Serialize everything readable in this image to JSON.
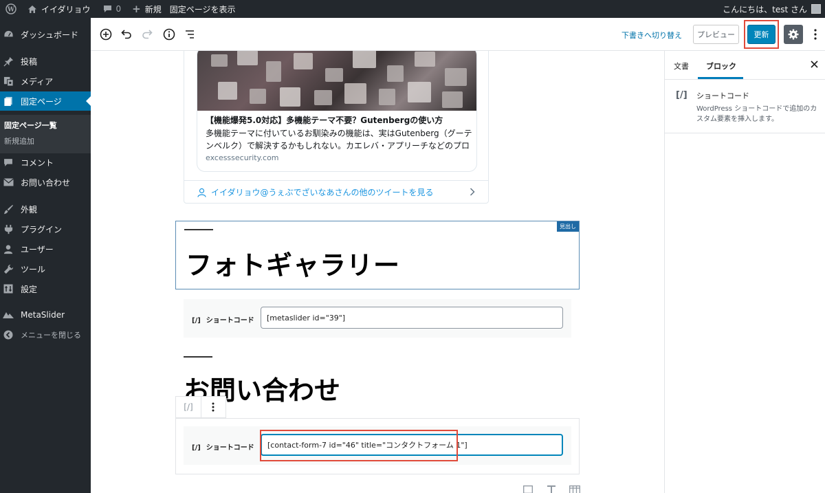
{
  "admin_bar": {
    "site_name": "イイダリョウ",
    "comments_count": "0",
    "new_label": "新規",
    "view_page_label": "固定ページを表示",
    "greeting": "こんにちは、test さん"
  },
  "sidebar": {
    "items": [
      {
        "label": "ダッシュボード",
        "icon": "dashboard-icon"
      },
      {
        "label": "投稿",
        "icon": "pin-icon"
      },
      {
        "label": "メディア",
        "icon": "media-icon"
      },
      {
        "label": "固定ページ",
        "icon": "page-icon"
      },
      {
        "label": "コメント",
        "icon": "comment-icon"
      },
      {
        "label": "お問い合わせ",
        "icon": "mail-icon"
      },
      {
        "label": "外観",
        "icon": "brush-icon"
      },
      {
        "label": "プラグイン",
        "icon": "plugin-icon"
      },
      {
        "label": "ユーザー",
        "icon": "user-icon"
      },
      {
        "label": "ツール",
        "icon": "wrench-icon"
      },
      {
        "label": "設定",
        "icon": "settings-icon"
      },
      {
        "label": "MetaSlider",
        "icon": "metaslider-icon"
      },
      {
        "label": "メニューを閉じる",
        "icon": "collapse-icon"
      }
    ],
    "submenu": [
      "固定ページ一覧",
      "新規追加"
    ]
  },
  "header": {
    "switch_draft": "下書きへ切り替え",
    "preview": "プレビュー",
    "update": "更新"
  },
  "embed": {
    "title": "【機能爆発5.0対応】多機能テーマ不要？Gutenbergの使い方",
    "description": "多機能テーマに付いているお馴染みの機能は、実はGutenberg（グーテンベルク）で解決するかもしれない。カエレバ・アプリーチなどのプロ",
    "domain": "excesssecurity.com",
    "more_tweets": "イイダリョウ@うぇぶでざいなあさんの他のツイートを見る"
  },
  "blocks": {
    "heading1": "フォトギャラリー",
    "heading1_label": "見出し",
    "shortcode_label": "ショートコード",
    "shortcode1_value": "[metaslider id=\"39\"]",
    "heading2": "お問い合わせ",
    "shortcode2_value": "[contact-form-7 id=\"46\" title=\"コンタクトフォーム 1\"]",
    "toolbar_icon": "[/]"
  },
  "panel": {
    "tab_document": "文書",
    "tab_block": "ブロック",
    "block_icon": "[/]",
    "block_title": "ショートコード",
    "block_description": "WordPress ショートコードで追加のカスタム要素を挿入します。"
  },
  "colors": {
    "admin_dark": "#23282d",
    "accent": "#0073aa",
    "primary_button": "#0085ba",
    "highlight": "#e04a3a"
  }
}
